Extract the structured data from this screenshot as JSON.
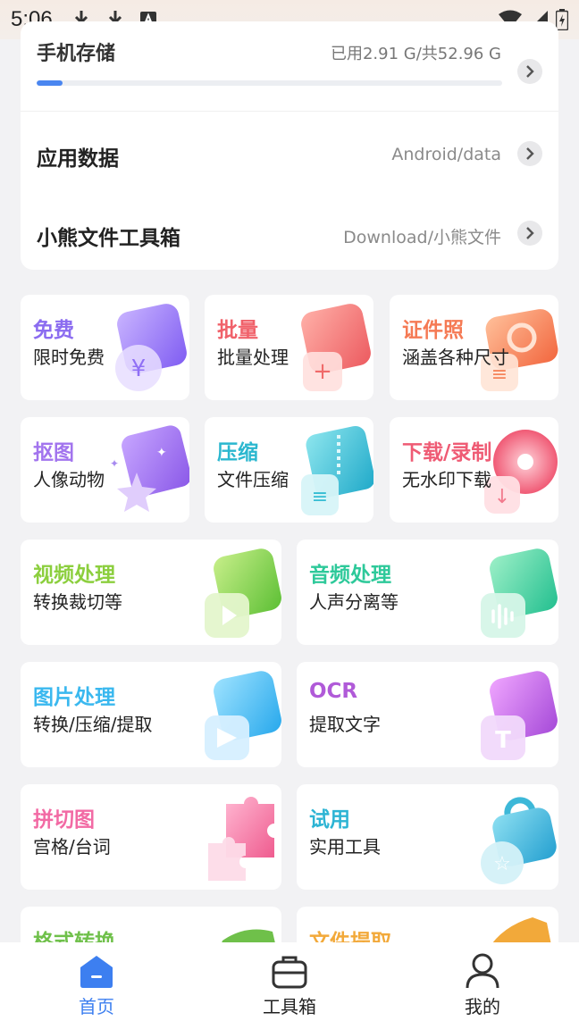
{
  "status_bar": {
    "time": "5:06"
  },
  "storage": {
    "title": "手机存储",
    "usage": "已用2.91 G/共52.96 G",
    "used_fraction": 0.055,
    "rows": [
      {
        "title": "应用数据",
        "path": "Android/data"
      },
      {
        "title": "小熊文件工具箱",
        "path": "Download/小熊文件"
      }
    ]
  },
  "tools_small": [
    {
      "title": "免费",
      "subtitle": "限时免费",
      "color": "#8b6cf0",
      "icon": "coin-icon"
    },
    {
      "title": "批量",
      "subtitle": "批量处理",
      "color": "#f0616a",
      "icon": "batch-icon"
    },
    {
      "title": "证件照",
      "subtitle": "涵盖各种尺寸",
      "color": "#f57a54",
      "icon": "id-photo-icon"
    },
    {
      "title": "抠图",
      "subtitle": "人像动物",
      "color": "#a274ee",
      "icon": "cutout-icon"
    },
    {
      "title": "压缩",
      "subtitle": "文件压缩",
      "color": "#2bb7cf",
      "icon": "zip-icon"
    },
    {
      "title": "下载/录制",
      "subtitle": "无水印下载",
      "color": "#ef5b74",
      "icon": "download-record-icon"
    }
  ],
  "tools_wide": [
    {
      "title": "视频处理",
      "subtitle": "转换裁切等",
      "color": "#8ccf3e",
      "icon": "video-icon"
    },
    {
      "title": "音频处理",
      "subtitle": "人声分离等",
      "color": "#2ec99a",
      "icon": "audio-icon"
    },
    {
      "title": "图片处理",
      "subtitle": "转换/压缩/提取",
      "color": "#3ab8ef",
      "icon": "image-icon"
    },
    {
      "title": "OCR",
      "subtitle": "提取文字",
      "color": "#b05ad8",
      "icon": "ocr-icon"
    },
    {
      "title": "拼切图",
      "subtitle": "宫格/台词",
      "color": "#f26aa4",
      "icon": "puzzle-icon"
    },
    {
      "title": "试用",
      "subtitle": "实用工具",
      "color": "#2db4d4",
      "icon": "trial-bag-icon"
    },
    {
      "title": "格式转换",
      "subtitle": "",
      "color": "#6fc04a",
      "icon": "format-icon"
    },
    {
      "title": "文件提取",
      "subtitle": "",
      "color": "#f2a93a",
      "icon": "extract-icon"
    }
  ],
  "bottom_nav": [
    {
      "label": "首页",
      "icon": "home-icon",
      "active": true
    },
    {
      "label": "工具箱",
      "icon": "toolbox-icon",
      "active": false
    },
    {
      "label": "我的",
      "icon": "profile-icon",
      "active": false
    }
  ],
  "colors": {
    "accent": "#3d7ff0",
    "progress": "#4a86f0"
  }
}
